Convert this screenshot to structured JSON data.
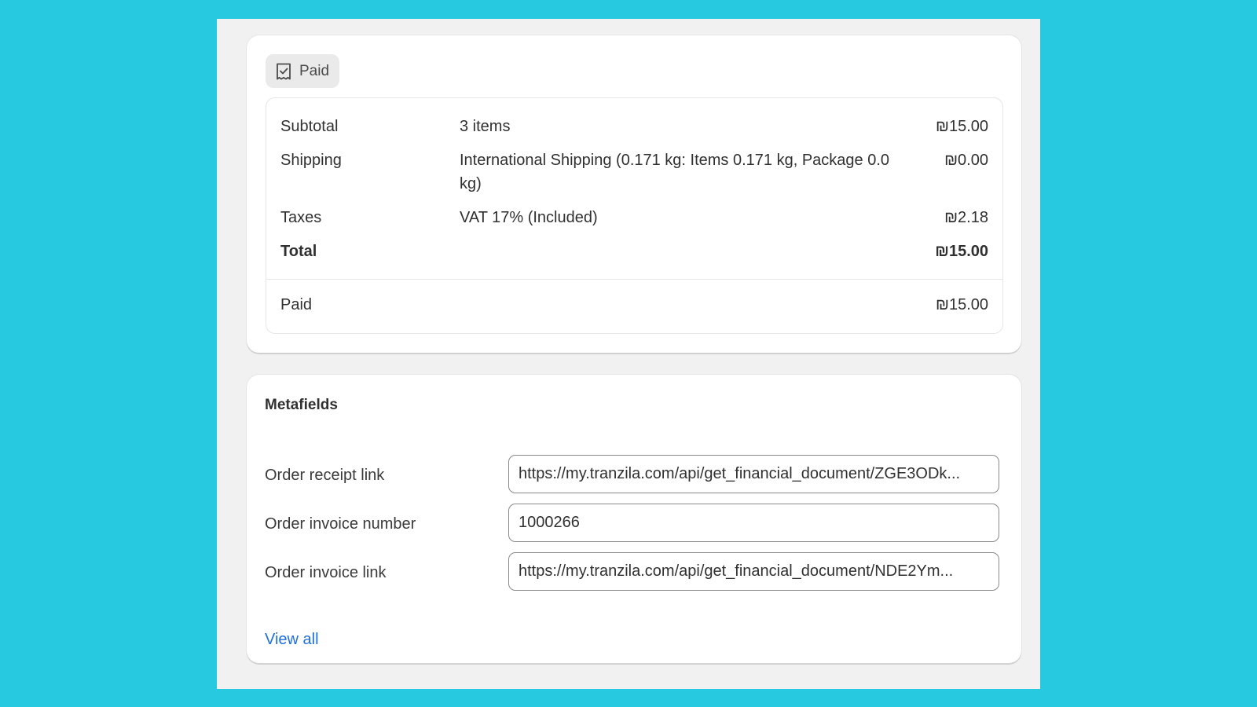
{
  "payment": {
    "status_badge": "Paid",
    "status_icon": "receipt-check-icon",
    "rows": {
      "subtotal": {
        "label": "Subtotal",
        "desc": "3 items",
        "amount": "₪15.00"
      },
      "shipping": {
        "label": "Shipping",
        "desc": "International Shipping (0.171 kg: Items 0.171 kg, Package 0.0 kg)",
        "amount": "₪0.00"
      },
      "taxes": {
        "label": "Taxes",
        "desc": "VAT 17% (Included)",
        "amount": "₪2.18"
      },
      "total": {
        "label": "Total",
        "amount": "₪15.00"
      },
      "paid": {
        "label": "Paid",
        "amount": "₪15.00"
      }
    }
  },
  "metafields": {
    "title": "Metafields",
    "fields": [
      {
        "label": "Order receipt link",
        "value": "https://my.tranzila.com/api/get_financial_document/ZGE3ODk..."
      },
      {
        "label": "Order invoice number",
        "value": "1000266"
      },
      {
        "label": "Order invoice link",
        "value": "https://my.tranzila.com/api/get_financial_document/NDE2Ym..."
      }
    ],
    "view_all": "View all"
  },
  "colors": {
    "background": "#27c9e0",
    "link": "#1f6fe0"
  }
}
